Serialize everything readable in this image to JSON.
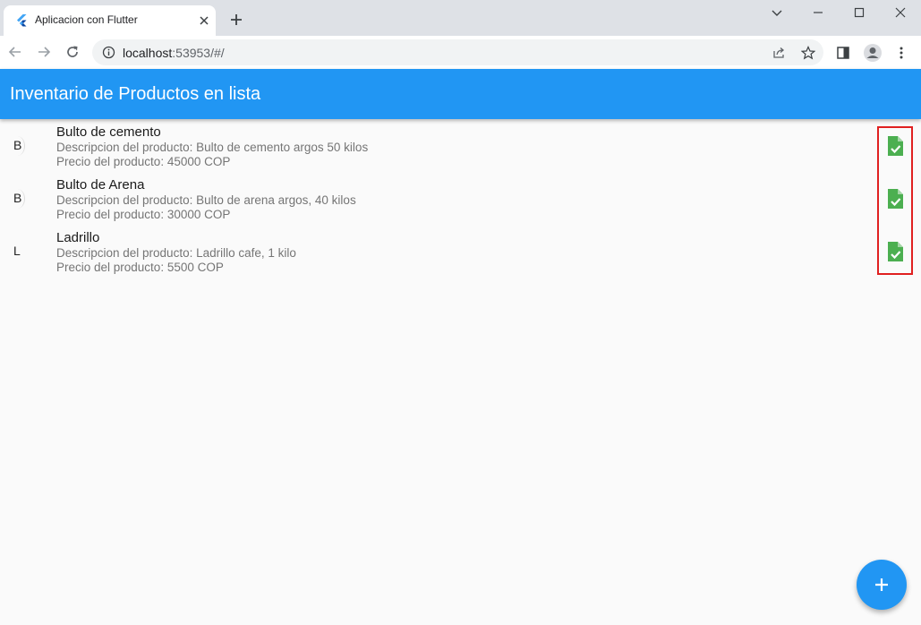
{
  "browser": {
    "tab_title": "Aplicacion con Flutter",
    "url_host": "localhost",
    "url_rest": ":53953/#/"
  },
  "app": {
    "title": "Inventario de Productos en lista",
    "primary_color": "#2196f3",
    "icon_color": "#4caf50",
    "products": [
      {
        "initial": "B",
        "name": "Bulto de cemento",
        "description": "Descripcion del producto: Bulto de cemento argos 50 kilos",
        "price": "Precio del producto:  45000 COP",
        "icon": "file-check-icon"
      },
      {
        "initial": "B",
        "name": "Bulto de Arena",
        "description": "Descripcion del producto: Bulto de arena argos, 40 kilos",
        "price": "Precio del producto:  30000 COP",
        "icon": "file-check-icon"
      },
      {
        "initial": "L",
        "name": "Ladrillo",
        "description": "Descripcion del producto: Ladrillo cafe, 1 kilo",
        "price": "Precio del producto:  5500 COP",
        "icon": "file-check-icon"
      }
    ],
    "fab_icon": "plus-icon"
  }
}
